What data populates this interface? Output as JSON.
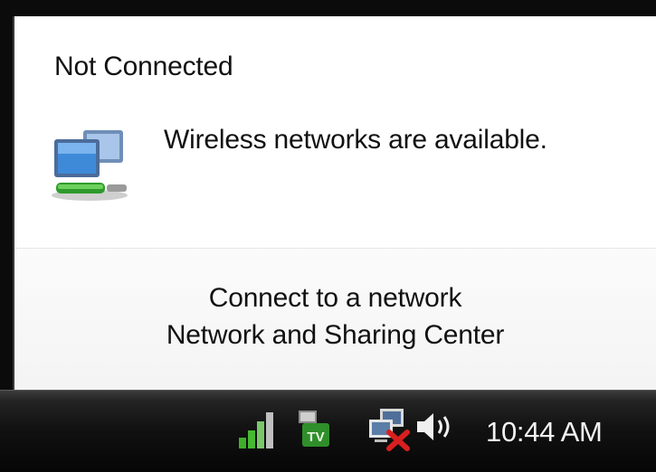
{
  "popup": {
    "status_title": "Not Connected",
    "status_message": "Wireless networks are available.",
    "status_icon": "network-computers-icon",
    "links": {
      "connect": "Connect to a network",
      "sharing_center": "Network and Sharing Center"
    }
  },
  "taskbar": {
    "tray_icons": [
      "signal-bars-icon",
      "teamviewer-icon",
      "network-disconnected-icon",
      "speaker-icon"
    ],
    "clock": "10:44 AM"
  },
  "colors": {
    "taskbar": "#121212",
    "popup_background": "#ffffff",
    "error_red": "#d81f1f",
    "tray_green": "#3fae2a"
  }
}
